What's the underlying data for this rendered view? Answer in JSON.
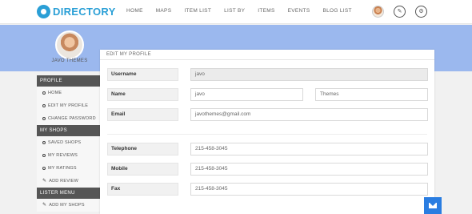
{
  "header": {
    "logo_text": "DIRECTORY",
    "nav": [
      "HOME",
      "MAPS",
      "ITEM LIST",
      "LIST BY",
      "ITEMS",
      "EVENTS",
      "BLOG LIST"
    ],
    "icons": [
      "user-avatar",
      "edit-icon",
      "settings-icon"
    ]
  },
  "profile": {
    "name": "JAVO THEMES"
  },
  "sidebar": {
    "sections": [
      {
        "title": "PROFILE",
        "items": [
          {
            "label": "HOME",
            "icon": "circle-icon"
          },
          {
            "label": "EDIT MY PROFILE",
            "icon": "circle-icon"
          },
          {
            "label": "CHANGE PASSWORD",
            "icon": "circle-icon"
          }
        ]
      },
      {
        "title": "MY SHOPS",
        "items": [
          {
            "label": "SAVED SHOPS",
            "icon": "circle-icon"
          },
          {
            "label": "MY REVIEWS",
            "icon": "circle-icon"
          },
          {
            "label": "MY RATINGS",
            "icon": "circle-icon"
          },
          {
            "label": "ADD REVIEW",
            "icon": "pencil-icon"
          }
        ]
      },
      {
        "title": "LISTER MENU",
        "items": [
          {
            "label": "ADD MY SHOPS",
            "icon": "pencil-icon"
          }
        ]
      }
    ]
  },
  "form": {
    "title": "EDIT MY PROFILE",
    "username_label": "Username",
    "username_value": "javo",
    "name_label": "Name",
    "first_name": "javo",
    "last_name": "Themes",
    "email_label": "Email",
    "email_value": "javothemes@gmail.com",
    "telephone_label": "Telephone",
    "telephone_value": "215-458-3045",
    "mobile_label": "Mobile",
    "mobile_value": "215-458-3045",
    "fax_label": "Fax",
    "fax_value": "215-458-3045"
  },
  "colors": {
    "accent": "#2a9fd6",
    "band": "#9bb8ee",
    "sidebar_header": "#555555",
    "mail_button": "#2a7de1"
  }
}
